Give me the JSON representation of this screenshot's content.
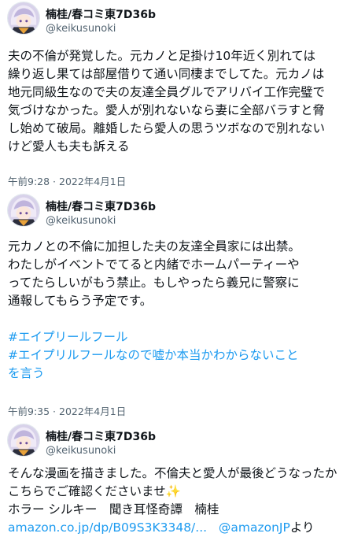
{
  "tweets": [
    {
      "display_name": "楠桂/春コミ東7D36b",
      "handle": "@keikusunoki",
      "lines": [
        "夫の不倫が発覚した。元カノと足掛け10年近く別れては",
        "繰り返し果ては部屋借りて通い同棲までしてた。元カノは",
        "地元同級生なので夫の友達全員グルでアリバイ工作完璧で",
        "気づけなかった。愛人が別れないなら妻に全部バラすと脅",
        "し始めて破局。離婚したら愛人の思うツボなので別れない",
        "けど愛人も夫も訴える"
      ],
      "timestamp": "午前9:28 · 2022年4月1日"
    },
    {
      "display_name": "楠桂/春コミ東7D36b",
      "handle": "@keikusunoki",
      "lines": [
        "元カノとの不倫に加担した夫の友達全員家には出禁。",
        "わたしがイベントでてると内緒でホームパーティーや",
        "ってたらしいがもう禁止。もしやったら義兄に警察に",
        "通報してもらう予定です。"
      ],
      "hashtags": [
        "#エイプリールフール",
        "#エイプリルフールなので嘘か本当かわからないこと",
        "を言う"
      ],
      "timestamp": "午前9:35 · 2022年4月1日"
    },
    {
      "display_name": "楠桂/春コミ東7D36b",
      "handle": "@keikusunoki",
      "lines": [
        "そんな漫画を描きました。不倫夫と愛人が最後どうなったか",
        "こちらでご確認くださいませ✨",
        "ホラー シルキー　聞き耳怪奇譚　楠桂"
      ],
      "link_url": "amazon.co.jp/dp/B09S3K3348/...",
      "link_mention": "@amazonJP",
      "link_suffix": "より"
    }
  ],
  "colors": {
    "text": "#0f1419",
    "secondary": "#536471",
    "link": "#1d9bf0"
  },
  "icons": [
    "avatar"
  ]
}
